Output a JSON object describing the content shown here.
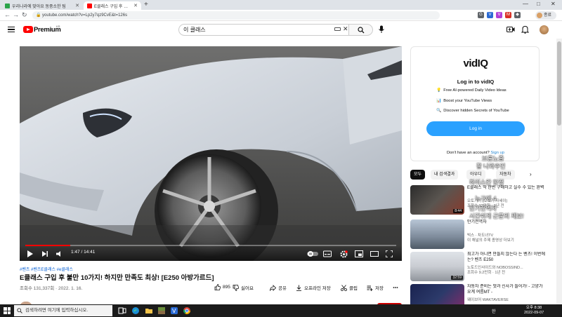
{
  "browser": {
    "tabs": [
      {
        "title": "우리나라에 맞아요 동중소한 팀",
        "favicon_color": "#2aa34a"
      },
      {
        "title": "E클래스 구입 후 불만 10가지! 하지만",
        "favicon_color": "#ff0000"
      }
    ],
    "new_tab": "+",
    "url": "youtube.com/watch?v=Lp2y7qz9CvE&t=126s",
    "profile_label": "종료",
    "window_controls": [
      "—",
      "□",
      "✕"
    ],
    "extensions": [
      {
        "icon": "extension-icon",
        "color": "#5f6368",
        "label": "G"
      },
      {
        "icon": "vpn-icon",
        "color": "#2a6ad4",
        "label": "V"
      },
      {
        "icon": "tool-icon",
        "color": "#b23fd6",
        "label": "V"
      },
      {
        "icon": "mail-icon",
        "color": "#d93025",
        "label": "M"
      },
      {
        "icon": "puzzle-icon",
        "color": "#5f6368",
        "label": "◆"
      }
    ]
  },
  "youtube": {
    "logo_text": "Premium",
    "logo_region": "KR",
    "search_query": "이 클래스"
  },
  "player": {
    "current_time": "1:47",
    "duration": "14:41",
    "time_display": "1:47 / 14:41",
    "progress_fraction": 0.121,
    "controls": [
      "play-icon",
      "next-icon",
      "volume-icon",
      "autoplay-toggle",
      "subtitles-icon",
      "settings-icon",
      "miniplayer-icon",
      "theater-icon",
      "fullscreen-icon"
    ]
  },
  "video": {
    "hashtags": "#벤츠 #벤츠E클래스 #e클래스",
    "title": "E클래스 구입 후 불만 10가지! 하지만 만족도 최상! [E250 아방가르드]",
    "views_date": "조회수 131,337회 · 2022. 1. 16.",
    "actions": {
      "like_count": "895",
      "dislike": "싫어요",
      "share": "공유",
      "download": "오프라인 저장",
      "clip": "클립",
      "save": "저장"
    }
  },
  "vidiq": {
    "logo": "vidIQ",
    "heading": "Log in to vidIQ",
    "features": [
      {
        "icon": "💡",
        "text": "Free AI-powered Daily Video Ideas"
      },
      {
        "icon": "📊",
        "text": "Boost your YouTube Views"
      },
      {
        "icon": "🔍",
        "text": "Discover hidden Secrets of YouTube"
      }
    ],
    "login_button": "Log in",
    "signup_prompt": "Don't have an account?",
    "signup_link": "Sign up"
  },
  "chips": [
    "모두",
    "내 검색결과",
    "아우디",
    "자동차"
  ],
  "recommended": [
    {
      "title": "E클래스 딱 한번 구매하고 실수 수 있는 완벽",
      "channel": "오토기어 (오토기 자세이)",
      "views": "조회수 12만회 · 1년 전",
      "duration": "8:44",
      "thumb": "#5a5550"
    },
    {
      "title": "만기전역자",
      "channel": "빅스 · 차도녀TV",
      "views": "이 채널의 주제 종영상 더보기",
      "duration": "",
      "thumb": "#9aa8b8"
    },
    {
      "title": "최고가 아니면 만들지 않는다 는 벤츠! 이번에는? 벤츠 E250",
      "channel": "노토드인사이드와 NOBOSSIND...",
      "views": "조회수 9.2만회 · 1년 전",
      "duration": "32:59",
      "thumb": "#c9ccd2"
    },
    {
      "title": "자동차 준비는 멋과 신사가 들어가! - 고양가요계 여름MT -",
      "channel": "웨이브어 WAKTAVERSE",
      "views": "",
      "duration": "",
      "thumb": "#2c3a6a"
    }
  ],
  "overlay_comments": [
    "브론노즐",
    "잘 나와주인",
    "하이스칸 한정",
    "누구에 4",
    "만기전역자",
    "시간쉬게 근문의 제보!"
  ],
  "taskbar": {
    "search_placeholder": "검색하려면 여기에 입력하십시오.",
    "time": "오후 8:38",
    "date": "2022-09-07",
    "tray_lang": "한"
  }
}
